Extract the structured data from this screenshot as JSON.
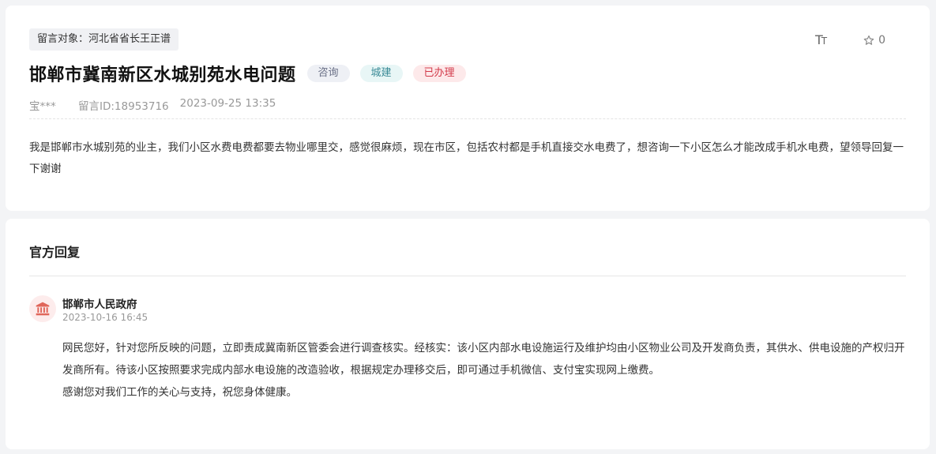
{
  "message": {
    "target_label": "留言对象：河北省省长王正谱",
    "title": "邯郸市冀南新区水城别苑水电问题",
    "tags": {
      "consult": "咨询",
      "category": "城建",
      "status": "已办理"
    },
    "author": "宝***",
    "msg_id": "留言ID:18953716",
    "datetime": "2023-09-25 13:35",
    "content": "我是邯郸市水城别苑的业主，我们小区水费电费都要去物业哪里交，感觉很麻烦，现在市区，包括农村都是手机直接交水电费了，想咨询一下小区怎么才能改成手机水电费，望领导回复一下谢谢"
  },
  "toolbar": {
    "font_size_icon": "font-size-icon",
    "fav_icon": "star-outline-icon",
    "fav_count": "0"
  },
  "reply_section": {
    "title": "官方回复",
    "org_name": "邯郸市人民政府",
    "org_icon": "government-building-icon",
    "datetime": "2023-10-16 16:45",
    "paragraph_1": "网民您好，针对您所反映的问题，立即责成冀南新区管委会进行调查核实。经核实：该小区内部水电设施运行及维护均由小区物业公司及开发商负责，其供水、供电设施的产权归开发商所有。待该小区按照要求完成内部水电设施的改造验收，根据规定办理移交后，即可通过手机微信、支付宝实现网上缴费。",
    "paragraph_2": "感谢您对我们工作的关心与支持，祝您身体健康。"
  },
  "colors": {
    "page_bg": "#f3f4f6",
    "tag_status_text": "#d23a4a",
    "tag_category_text": "#3a8a96",
    "avatar_accent": "#e0665a"
  }
}
